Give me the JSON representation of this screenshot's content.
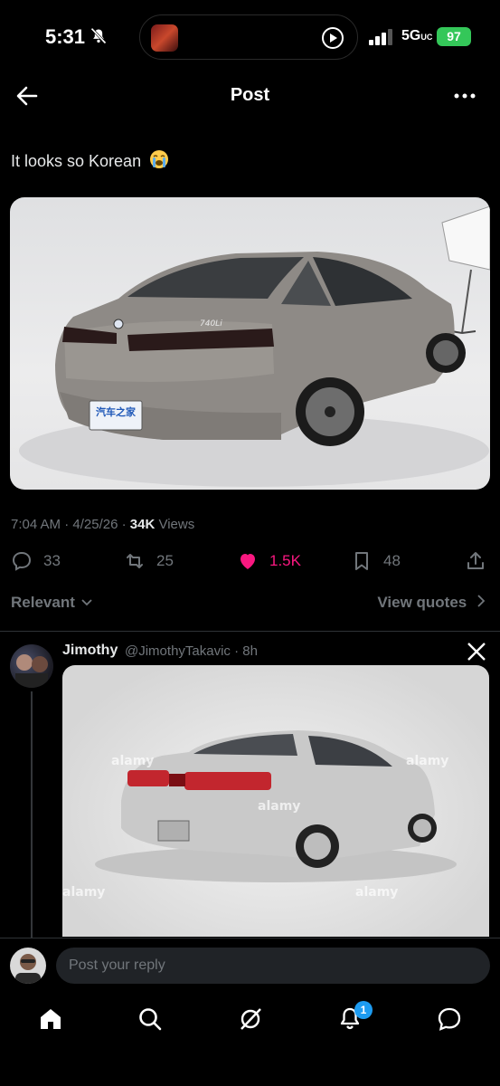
{
  "status_bar": {
    "time": "5:31",
    "network": "5G",
    "network_sub": "UC",
    "battery": "97"
  },
  "header": {
    "title": "Post"
  },
  "post": {
    "text": "It looks so Korean",
    "image_text": {
      "badge": "汽车之家",
      "model": "740Li"
    },
    "time": "7:04 AM",
    "date": "4/25/26",
    "views_count": "34K",
    "views_label": "Views",
    "stats": {
      "replies": "33",
      "reposts": "25",
      "likes": "1.5K",
      "bookmarks": "48"
    }
  },
  "sort": {
    "relevant_label": "Relevant",
    "view_quotes_label": "View quotes"
  },
  "reply": {
    "name": "Jimothy",
    "handle": "@JimothyTakavic",
    "age": "8h",
    "image_watermark": "alamy"
  },
  "compose": {
    "placeholder": "Post your reply"
  },
  "tabbar": {
    "notification_count": "1"
  },
  "colors": {
    "background": "#000000",
    "text": "#e7e9ea",
    "muted": "#71767b",
    "like": "#f91880",
    "accent": "#1d9bf0",
    "battery": "#34c759"
  },
  "icons": [
    "bell-slash-icon",
    "play-icon",
    "signal-icon",
    "back-arrow-icon",
    "more-icon",
    "loudly-crying-emoji",
    "reply-icon",
    "repost-icon",
    "heart-icon",
    "bookmark-icon",
    "share-icon",
    "chevron-down-icon",
    "chevron-right-icon",
    "x-logo-icon",
    "home-icon",
    "search-icon",
    "grok-icon",
    "bell-icon",
    "messages-icon"
  ]
}
